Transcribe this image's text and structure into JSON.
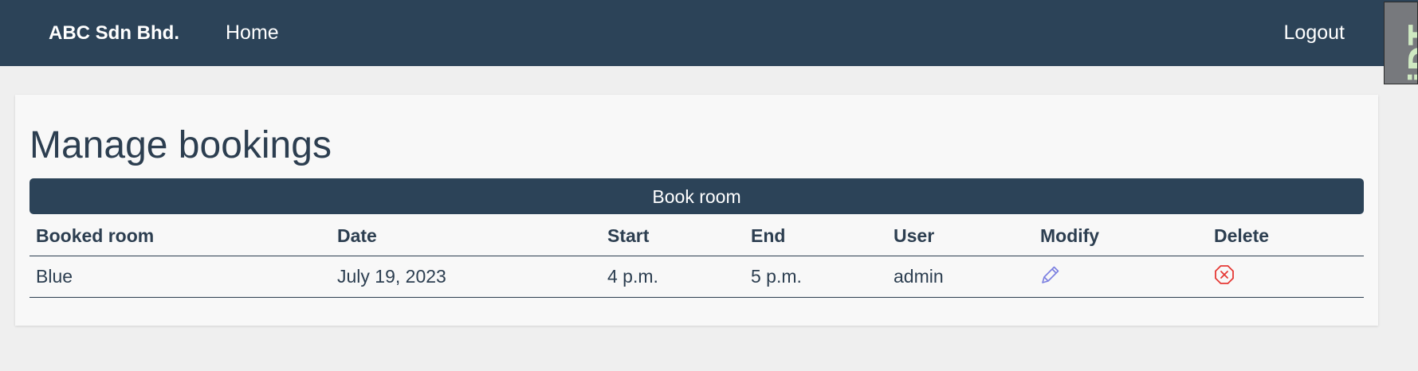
{
  "navbar": {
    "brand": "ABC Sdn Bhd.",
    "home": "Home",
    "logout": "Logout",
    "background": "#2c4358"
  },
  "debug_toolbar": {
    "handle_label": "DjDT"
  },
  "main": {
    "title": "Manage bookings",
    "book_button": "Book room",
    "table": {
      "headers": [
        "Booked room",
        "Date",
        "Start",
        "End",
        "User",
        "Modify",
        "Delete"
      ],
      "rows": [
        {
          "room": "Blue",
          "date": "July 19, 2023",
          "start": "4 p.m.",
          "end": "5 p.m.",
          "user": "admin",
          "modify_icon": "pencil-icon",
          "delete_icon": "circle-x-icon"
        }
      ]
    }
  },
  "colors": {
    "primary": "#2c4358",
    "text": "#2c3e50",
    "modify_icon": "#7b7fe0",
    "delete_icon": "#e53935"
  }
}
